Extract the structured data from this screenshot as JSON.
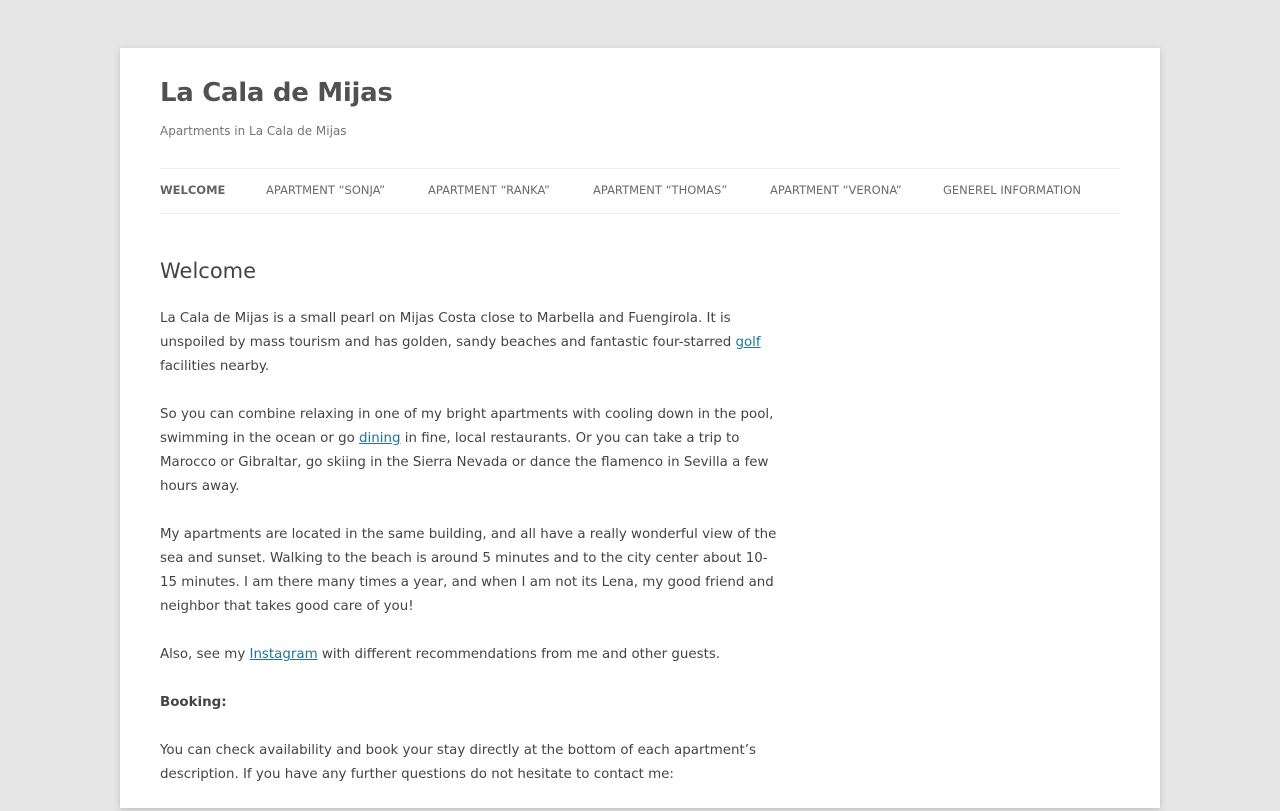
{
  "site": {
    "title": "La Cala de Mijas",
    "description": "Apartments in La Cala de Mijas"
  },
  "nav": {
    "items": [
      {
        "label": "WELCOME",
        "current": true
      },
      {
        "label": "APARTMENT “SONJA”",
        "current": false
      },
      {
        "label": "APARTMENT “RANKA”",
        "current": false
      },
      {
        "label": "APARTMENT “THOMAS”",
        "current": false
      },
      {
        "label": "APARTMENT “VERONA”",
        "current": false
      },
      {
        "label": "GENEREL INFORMATION",
        "current": false
      }
    ]
  },
  "page": {
    "title": "Welcome",
    "p1": {
      "before": "La Cala de Mijas is a small pearl on Mijas Costa close to Marbella and Fuengirola. It is unspoiled by mass tourism and has golden, sandy beaches and fantastic four-starred ",
      "link": "golf",
      "after": " facilities nearby."
    },
    "p2": {
      "before": "So you can combine relaxing in one of my bright apartments with cooling down in the pool, swimming in the ocean or go ",
      "link": "dining",
      "after": " in fine, local restaurants. Or you can take a trip to Marocco or Gibraltar, go skiing in the Sierra Nevada or dance the flamenco in Sevilla a few hours away."
    },
    "p3": "My apartments are located in the same building, and all have a really wonderful view of the sea and sunset. Walking to the beach is around 5 minutes and to the city center about 10-15 minutes. I am there many times a year, and when I am not its Lena, my good friend and neighbor that takes good care of you!",
    "p4": {
      "before": "Also, see my ",
      "link": "Instagram",
      "after": " with different recommendations from me and other guests."
    },
    "booking_heading": "Booking:",
    "p5": "You can check availability and book your stay directly at the bottom of each apartment’s description. If you have any further questions do not hesitate to contact me:"
  },
  "colors": {
    "page_background": "#e6e6e6",
    "content_background": "#ffffff",
    "link": "#21759b",
    "text": "#444444",
    "title": "#515151"
  }
}
